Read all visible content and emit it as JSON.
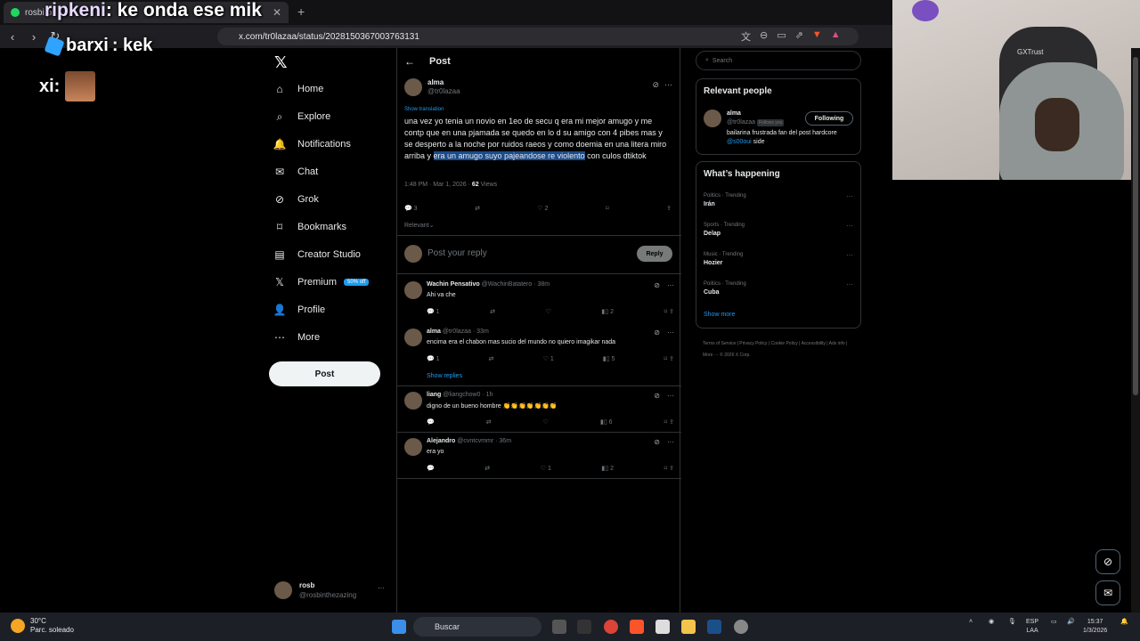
{
  "browser": {
    "tab_title": "rosbi p",
    "url": "x.com/tr0lazaa/status/2028150367003763131"
  },
  "overlay": {
    "line1_name": "ripkeni",
    "line1_msg": ": ke onda ese mik",
    "line2_name": "barxi",
    "line2_msg": ": kek",
    "line3_name": "xi:"
  },
  "nav": {
    "items": [
      {
        "label": "Home",
        "icon": "home-icon"
      },
      {
        "label": "Explore",
        "icon": "search-icon"
      },
      {
        "label": "Notifications",
        "icon": "bell-icon"
      },
      {
        "label": "Chat",
        "icon": "chat-icon"
      },
      {
        "label": "Grok",
        "icon": "grok-icon"
      },
      {
        "label": "Bookmarks",
        "icon": "bookmark-icon"
      },
      {
        "label": "Creator Studio",
        "icon": "creator-icon"
      },
      {
        "label": "Premium",
        "icon": "x-icon",
        "badge": "50% off"
      },
      {
        "label": "Profile",
        "icon": "person-icon"
      },
      {
        "label": "More",
        "icon": "more-icon"
      }
    ],
    "post_button": "Post",
    "account_name": "rosb",
    "account_handle": "@rosbinthezazing"
  },
  "main": {
    "header": "Post",
    "author_name": "alma",
    "author_handle": "@tr0lazaa",
    "show_translation": "Show translation",
    "body_before": "una vez yo tenia un novio en 1eo de secu q era mi mejor amugo y me contp que en una pjamada se quedo en lo d su amigo con 4 pibes mas y se desperto a la noche por ruidos raeos y como doemia en una litera miro arriba y ",
    "body_highlight": "era un amugo suyo pajeandose re violento",
    "body_after": " con culos dtiktok",
    "time": "1:48 PM · Mar 1, 2026 · ",
    "views_count": "62",
    "views_label": " Views",
    "replies_count": "3",
    "likes_count": "2",
    "sort": "Relevant",
    "reply_placeholder": "Post your reply",
    "reply_button": "Reply"
  },
  "replies": [
    {
      "name": "Wachin Pensativo",
      "meta": "@WachinBatatero · 38m",
      "text": "Ahi va che",
      "r": "1",
      "l": "",
      "v": "2"
    },
    {
      "name": "alma",
      "meta": "@tr0lazaa · 33m",
      "text": "encima era el chabon mas sucio del mundo no quiero imagikar nada",
      "r": "1",
      "l": "1",
      "v": "5"
    },
    {
      "name": "liang",
      "meta": "@liangchow0 · 1h",
      "text": "digno de un bueno hombre 👏👏👏👏👏👏👏",
      "r": "",
      "l": "",
      "v": "6"
    },
    {
      "name": "Alejandro",
      "meta": "@cvntcvmmr · 36m",
      "text": "era yo",
      "r": "",
      "l": "1",
      "v": "2"
    }
  ],
  "show_replies": "Show replies",
  "sidebar": {
    "search_placeholder": "Search",
    "relevant_title": "Relevant people",
    "rel_name": "alma",
    "rel_handle": "@tr0lazaa",
    "follows_you": "Follows you",
    "following": "Following",
    "bio_before": "bailarina frustrada fan del post hardcore ",
    "bio_link": "@s00oui",
    "bio_after": " side",
    "happening_title": "What’s happening",
    "trends": [
      {
        "cat": "Politics · Trending",
        "name": "Irán"
      },
      {
        "cat": "Sports · Trending",
        "name": "Delap"
      },
      {
        "cat": "Music · Trending",
        "name": "Hozier"
      },
      {
        "cat": "Politics · Trending",
        "name": "Cuba"
      }
    ],
    "show_more": "Show more",
    "footer": "Terms of Service | Privacy Policy | Cookie Policy | Accessibility | Ads info | More ··· © 2026 X Corp."
  },
  "webcam": {
    "brand": "GXTrust"
  },
  "taskbar": {
    "temp": "30°C",
    "weather": "Parc. soleado",
    "search": "Buscar",
    "lang1": "ESP",
    "lang2": "LAA",
    "time": "15:37",
    "date": "1/3/2026"
  }
}
